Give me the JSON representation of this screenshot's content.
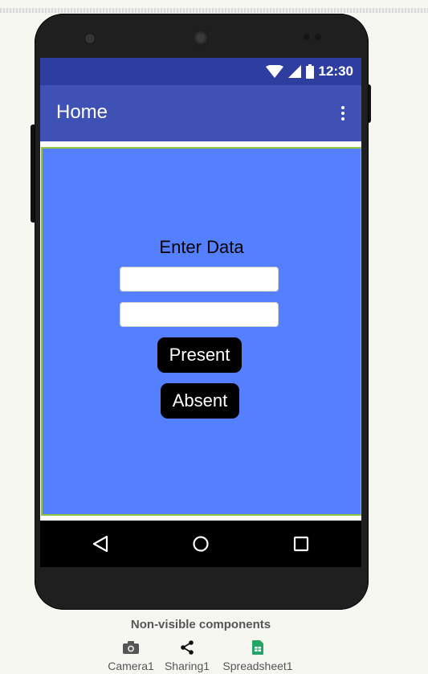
{
  "status_bar": {
    "time": "12:30"
  },
  "app_bar": {
    "title": "Home",
    "menu_icon": "more-vert-icon"
  },
  "form": {
    "heading": "Enter Data",
    "field1_value": "",
    "field2_value": "",
    "present_label": "Present",
    "absent_label": "Absent"
  },
  "nav": {
    "back_icon": "back-triangle-icon",
    "home_icon": "home-circle-icon",
    "recents_icon": "recents-square-icon"
  },
  "non_visible": {
    "title": "Non-visible components",
    "items": [
      {
        "label": "Camera1",
        "icon": "camera-icon"
      },
      {
        "label": "Sharing1",
        "icon": "share-icon"
      },
      {
        "label": "Spreadsheet1",
        "icon": "spreadsheet-icon"
      }
    ]
  },
  "colors": {
    "status_bar": "#2d3ea0",
    "app_bar": "#3f51b5",
    "content_bg": "#5480ff",
    "content_border": "#8ec63f",
    "button_bg": "#000000"
  }
}
